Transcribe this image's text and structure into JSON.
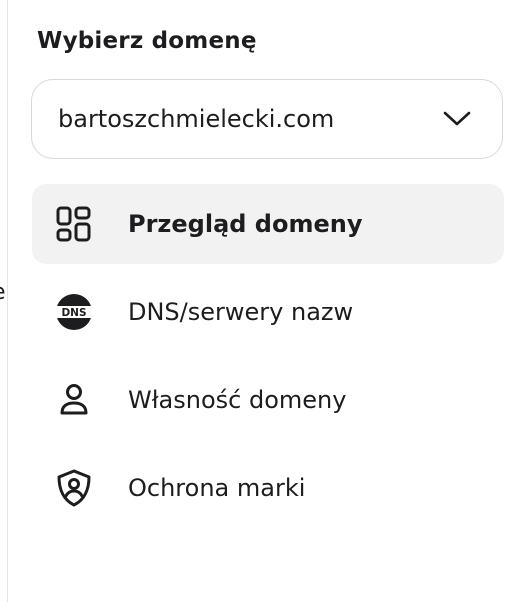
{
  "left_edge_text": "e",
  "sidebar": {
    "heading": "Wybierz domenę",
    "domain_select": {
      "value": "bartoszchmielecki.com",
      "icon": "chevron-down-icon"
    },
    "items": [
      {
        "label": "Przegląd domeny",
        "icon": "dashboard-grid-icon",
        "active": true
      },
      {
        "label": "DNS/serwery nazw",
        "icon": "dns-icon",
        "icon_text": "DNS",
        "active": false
      },
      {
        "label": "Własność domeny",
        "icon": "person-icon",
        "active": false
      },
      {
        "label": "Ochrona marki",
        "icon": "shield-user-icon",
        "active": false
      }
    ]
  }
}
